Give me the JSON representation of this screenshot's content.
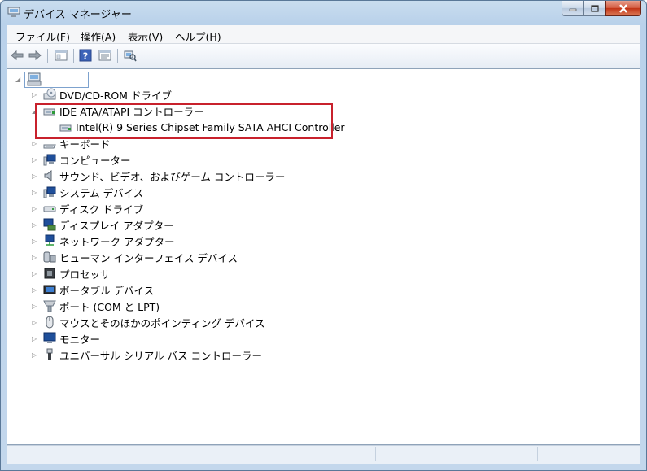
{
  "window": {
    "title": "デバイス マネージャー"
  },
  "menu": [
    "ファイル(F)",
    "操作(A)",
    "表示(V)",
    "ヘルプ(H)"
  ],
  "toolbar": {
    "buttons": [
      "back-icon",
      "forward-icon",
      "show-hide-tree-icon",
      "help-icon",
      "properties-icon",
      "scan-hardware-icon"
    ]
  },
  "tree": {
    "root": {
      "label": "",
      "icon": "computer-icon"
    },
    "items": [
      {
        "label": "DVD/CD-ROM ドライブ",
        "icon": "dvd-drive-icon",
        "expanded": false
      },
      {
        "label": "IDE ATA/ATAPI コントローラー",
        "icon": "ide-controller-icon",
        "expanded": true,
        "children": [
          {
            "label": "Intel(R) 9 Series Chipset Family SATA AHCI Controller",
            "icon": "ide-controller-icon"
          }
        ]
      },
      {
        "label": "キーボード",
        "icon": "keyboard-icon",
        "expanded": false
      },
      {
        "label": "コンピューター",
        "icon": "computer-icon",
        "expanded": false
      },
      {
        "label": "サウンド、ビデオ、およびゲーム コントローラー",
        "icon": "speaker-icon",
        "expanded": false
      },
      {
        "label": "システム デバイス",
        "icon": "system-device-icon",
        "expanded": false
      },
      {
        "label": "ディスク ドライブ",
        "icon": "disk-drive-icon",
        "expanded": false
      },
      {
        "label": "ディスプレイ アダプター",
        "icon": "display-adapter-icon",
        "expanded": false
      },
      {
        "label": "ネットワーク アダプター",
        "icon": "network-adapter-icon",
        "expanded": false
      },
      {
        "label": "ヒューマン インターフェイス デバイス",
        "icon": "hid-icon",
        "expanded": false
      },
      {
        "label": "プロセッサ",
        "icon": "processor-icon",
        "expanded": false
      },
      {
        "label": "ポータブル デバイス",
        "icon": "portable-device-icon",
        "expanded": false
      },
      {
        "label": "ポート (COM と LPT)",
        "icon": "port-icon",
        "expanded": false
      },
      {
        "label": "マウスとそのほかのポインティング デバイス",
        "icon": "mouse-icon",
        "expanded": false
      },
      {
        "label": "モニター",
        "icon": "monitor-icon",
        "expanded": false
      },
      {
        "label": "ユニバーサル シリアル バス コントローラー",
        "icon": "usb-icon",
        "expanded": false
      }
    ]
  },
  "colors": {
    "highlight_border": "#c8212c",
    "window_frame": "#b9d1ea",
    "close_button": "#c13416"
  }
}
